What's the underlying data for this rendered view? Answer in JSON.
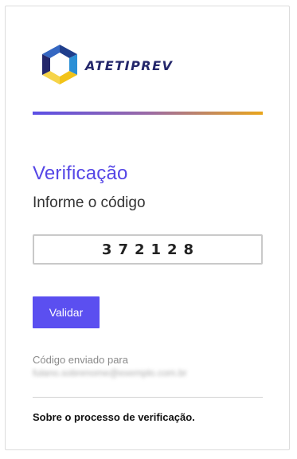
{
  "brand": {
    "name": "ATETIPREV",
    "colors": {
      "navy": "#24276b",
      "gold": "#f2c318",
      "purple": "#5546e6"
    }
  },
  "accent_bar": {
    "colors": [
      "#5b4fe6",
      "#9a6aa6",
      "#e9a51c"
    ]
  },
  "verification": {
    "title": "Verificação",
    "subtitle": "Informe o código",
    "code_value": "372128",
    "validate_label": "Validar",
    "sent_label": "Código enviado para",
    "sent_email": "fulano.sobrenome@exemplo.com.br",
    "about_link": "Sobre o processo de verificação."
  }
}
